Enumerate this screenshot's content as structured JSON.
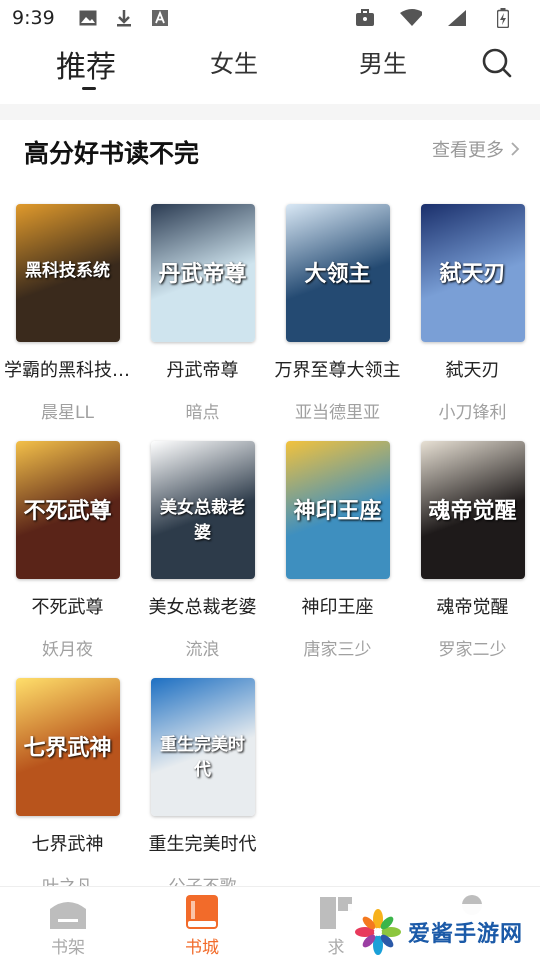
{
  "status_bar": {
    "time": "9:39"
  },
  "top_tabs": {
    "tabs": [
      {
        "label": "推荐"
      },
      {
        "label": "女生"
      },
      {
        "label": "男生"
      }
    ]
  },
  "section": {
    "title": "高分好书读不完",
    "more_label": "查看更多"
  },
  "books": [
    {
      "title": "学霸的黑科技系统",
      "author": "晨星LL",
      "cover_text": "黑科技系统",
      "cover_color": "#3a2a1c",
      "cover_accent": "#e09a2c"
    },
    {
      "title": "丹武帝尊",
      "author": "暗点",
      "cover_text": "丹武帝尊",
      "cover_color": "#cfe4ee",
      "cover_accent": "#2b3b52"
    },
    {
      "title": "万界至尊大领主",
      "author": "亚当德里亚",
      "cover_text": "大领主",
      "cover_color": "#244a72",
      "cover_accent": "#d9e8f5"
    },
    {
      "title": "弑天刃",
      "author": "小刀锋利",
      "cover_text": "弑天刃",
      "cover_color": "#7a9fd6",
      "cover_accent": "#1a2f6b"
    },
    {
      "title": "不死武尊",
      "author": "妖月夜",
      "cover_text": "不死武尊",
      "cover_color": "#5a2418",
      "cover_accent": "#f3c04a"
    },
    {
      "title": "美女总裁老婆",
      "author": "流浪",
      "cover_text": "美女总裁老婆",
      "cover_color": "#2d3b4a",
      "cover_accent": "#ffffff"
    },
    {
      "title": "神印王座",
      "author": "唐家三少",
      "cover_text": "神印王座",
      "cover_color": "#3e8fbf",
      "cover_accent": "#f2c23d"
    },
    {
      "title": "魂帝觉醒",
      "author": "罗家二少",
      "cover_text": "魂帝觉醒",
      "cover_color": "#1e1a1a",
      "cover_accent": "#e7e0d4"
    },
    {
      "title": "七界武神",
      "author": "叶之凡",
      "cover_text": "七界武神",
      "cover_color": "#b8541c",
      "cover_accent": "#ffdf6b"
    },
    {
      "title": "重生完美时代",
      "author": "公子不歌",
      "cover_text": "重生完美时代",
      "cover_color": "#e8ecef",
      "cover_accent": "#1d6fc2"
    }
  ],
  "bottom_nav": {
    "items": [
      {
        "label": "书架"
      },
      {
        "label": "书城"
      },
      {
        "label": "求"
      }
    ]
  },
  "watermark": {
    "text": "爱酱手游网"
  },
  "colors": {
    "accent": "#f26b2a",
    "muted": "#a0a0a0"
  }
}
